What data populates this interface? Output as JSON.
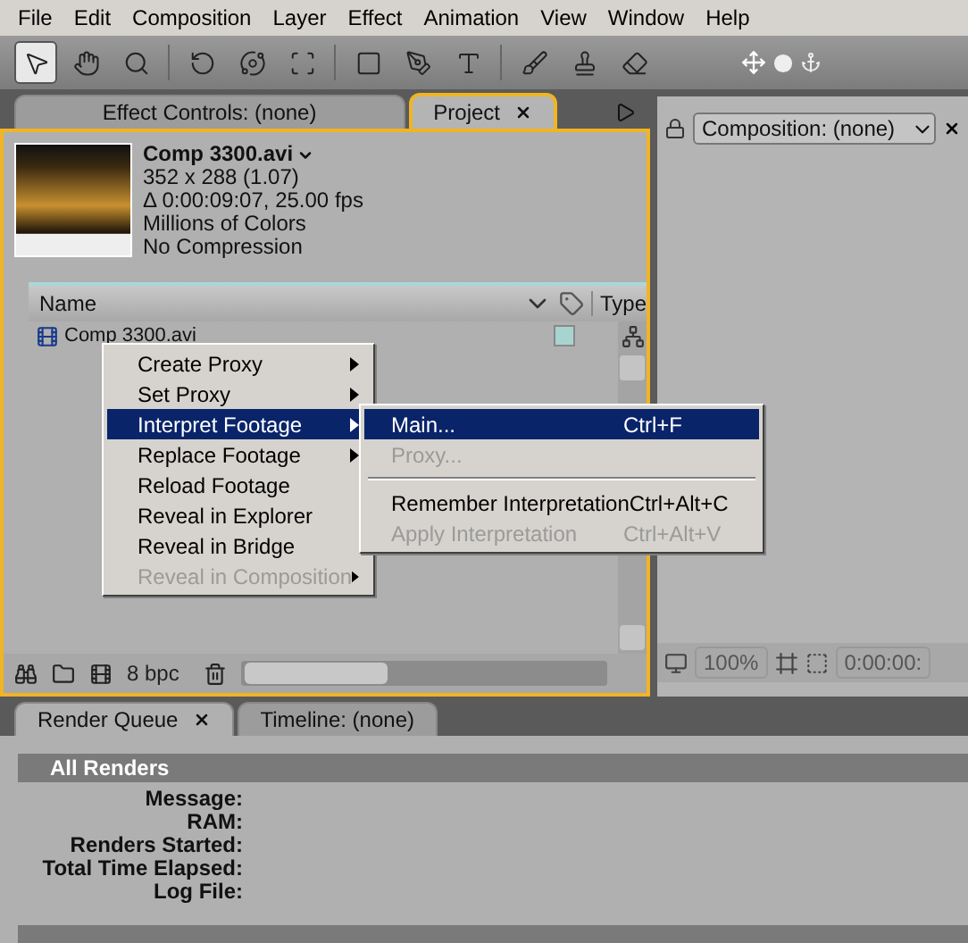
{
  "menubar": [
    "File",
    "Edit",
    "Composition",
    "Layer",
    "Effect",
    "Animation",
    "View",
    "Window",
    "Help"
  ],
  "toolbar": {
    "tools": [
      {
        "selected": true
      },
      {
        "selected": false
      },
      {
        "selected": false
      },
      {
        "selected": false
      },
      {
        "selected": false
      },
      {
        "selected": false
      },
      {
        "selected": false
      },
      {
        "selected": false
      },
      {
        "selected": false
      },
      {
        "selected": false
      },
      {
        "selected": false
      },
      {
        "selected": false
      }
    ]
  },
  "left_tabs": [
    {
      "label": "Effect Controls: (none)",
      "selected": false,
      "closable": false
    },
    {
      "label": "Project",
      "selected": true,
      "closable": true
    }
  ],
  "footage_info": {
    "name": "Comp 3300.avi",
    "lines": [
      "352 x 288 (1.07)",
      "Δ 0:00:09:07, 25.00 fps",
      "Millions of Colors",
      "No Compression"
    ]
  },
  "project_columns": {
    "name": "Name",
    "type": "Type"
  },
  "project_rows": [
    {
      "name": "Comp 3300.avi",
      "selected": false,
      "color": "#a8d4d0"
    }
  ],
  "project_footer": {
    "depth": "8 bpc"
  },
  "context_menu": [
    {
      "label": "Create Proxy",
      "submenu": true,
      "disabled": false,
      "selected": false
    },
    {
      "label": "Set Proxy",
      "submenu": true,
      "disabled": false,
      "selected": false
    },
    {
      "label": "Interpret Footage",
      "submenu": true,
      "disabled": false,
      "selected": true
    },
    {
      "label": "Replace Footage",
      "submenu": true,
      "disabled": false,
      "selected": false
    },
    {
      "label": "Reload Footage",
      "submenu": false,
      "disabled": false,
      "selected": false
    },
    {
      "label": "Reveal in Explorer",
      "submenu": false,
      "disabled": false,
      "selected": false
    },
    {
      "label": "Reveal in Bridge",
      "submenu": false,
      "disabled": false,
      "selected": false
    },
    {
      "label": "Reveal in Composition",
      "submenu": true,
      "disabled": true,
      "selected": false
    }
  ],
  "submenu": [
    {
      "kind": "item",
      "label": "Main...",
      "shortcut": "Ctrl+F",
      "disabled": false,
      "selected": true
    },
    {
      "kind": "item",
      "label": "Proxy...",
      "disabled": true,
      "selected": false
    },
    {
      "kind": "separator"
    },
    {
      "kind": "item",
      "label": "Remember Interpretation",
      "shortcut": "Ctrl+Alt+C",
      "disabled": false,
      "selected": false
    },
    {
      "kind": "item",
      "label": "Apply Interpretation",
      "shortcut": "Ctrl+Alt+V",
      "disabled": true,
      "selected": false
    }
  ],
  "composition_panel": {
    "dropdown": "Composition: (none)",
    "zoom": "100%",
    "timecode": "0:00:00:"
  },
  "bottom_tabs": [
    {
      "label": "Render Queue",
      "selected": true,
      "closable": true
    },
    {
      "label": "Timeline: (none)",
      "selected": false,
      "closable": false
    }
  ],
  "render_queue": {
    "section": "All Renders",
    "fields": [
      "Message:",
      "RAM:",
      "Renders Started:",
      "Total Time Elapsed:",
      "Log File:"
    ]
  }
}
